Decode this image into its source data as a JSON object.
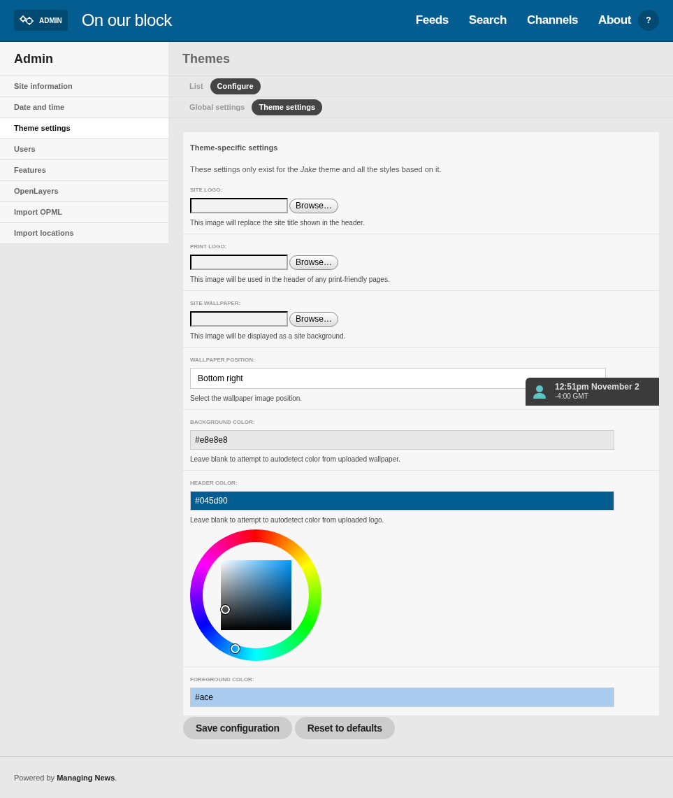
{
  "header": {
    "badge": "ADMIN",
    "site_title": "On our block",
    "nav": [
      "Feeds",
      "Search",
      "Channels",
      "About"
    ],
    "help": "?"
  },
  "sidebar": {
    "title": "Admin",
    "items": [
      {
        "label": "Site information",
        "selected": false
      },
      {
        "label": "Date and time",
        "selected": false
      },
      {
        "label": "Theme settings",
        "selected": true
      },
      {
        "label": "Users",
        "selected": false
      },
      {
        "label": "Features",
        "selected": false
      },
      {
        "label": "OpenLayers",
        "selected": false
      },
      {
        "label": "Import OPML",
        "selected": false
      },
      {
        "label": "Import locations",
        "selected": false
      }
    ]
  },
  "page_title": "Themes",
  "tab_rows": [
    [
      {
        "label": "List",
        "selected": false
      },
      {
        "label": "Configure",
        "selected": true
      }
    ],
    [
      {
        "label": "Global settings",
        "selected": false
      },
      {
        "label": "Theme settings",
        "selected": true
      }
    ]
  ],
  "form": {
    "heading": "Theme-specific settings",
    "intro": "These settings only exist for the *Jake* theme and all the styles based on it.",
    "sections": [
      {
        "kind": "file",
        "label": "SITE LOGO:",
        "button": "Browse…",
        "description": "This image will replace the site title shown in the header."
      },
      {
        "kind": "file",
        "label": "PRINT LOGO:",
        "button": "Browse…",
        "description": "This image will be used in the header of any print-friendly pages."
      },
      {
        "kind": "file",
        "label": "SITE WALLPAPER:",
        "button": "Browse…",
        "description": "This image will be displayed as a site background."
      },
      {
        "kind": "select",
        "label": "WALLPAPER POSITION:",
        "value": "Bottom right",
        "description": "Select the wallpaper image position."
      },
      {
        "kind": "color",
        "label": "BACKGROUND COLOR:",
        "value": "#e8e8e8",
        "description": "Leave blank to attempt to autodetect color from uploaded wallpaper.",
        "picker_open": false
      },
      {
        "kind": "color",
        "label": "HEADER COLOR:",
        "value": "#045d90",
        "description": "Leave blank to attempt to autodetect color from uploaded logo.",
        "picker_open": true
      },
      {
        "kind": "color",
        "label": "FOREGROUND COLOR:",
        "value": "#ace",
        "picker_open": false
      }
    ]
  },
  "buttons": [
    "Save configuration",
    "Reset to defaults"
  ],
  "clock": {
    "time": "12:51pm November 2",
    "zone": "-4:00 GMT"
  },
  "footer": "Powered by **Managing News**."
}
